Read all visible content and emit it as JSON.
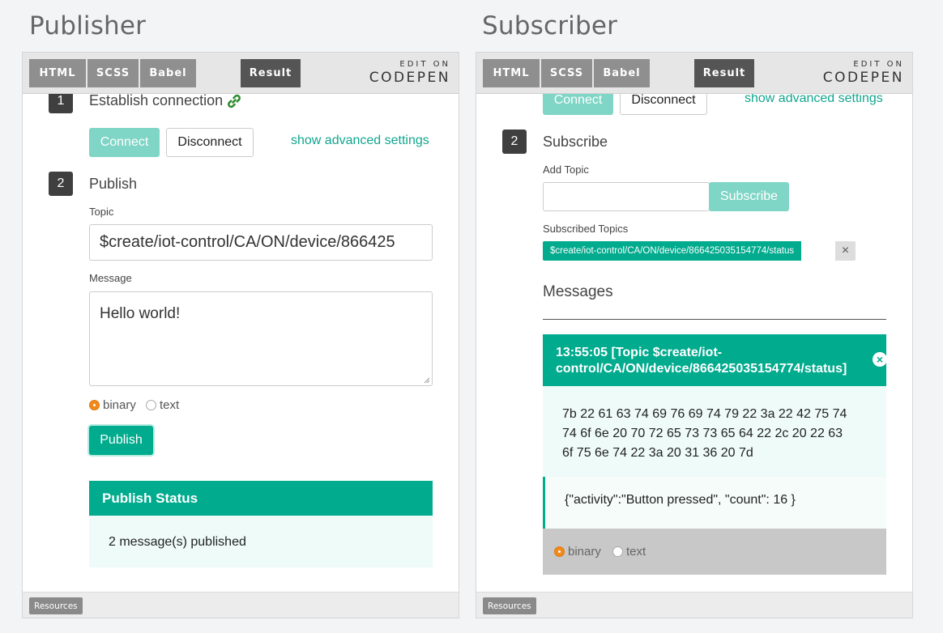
{
  "colors": {
    "accent": "#00ab8e",
    "accent_light": "#7fd5c6",
    "link": "#12a58f",
    "radio_on": "#f08a1c"
  },
  "codepen": {
    "tabs": [
      "HTML",
      "SCSS",
      "Babel"
    ],
    "result": "Result",
    "edit_on": "EDIT ON",
    "brand": "CODEPEN",
    "resources": "Resources"
  },
  "publisher": {
    "title": "Publisher",
    "step1": {
      "number": "1",
      "label": "Establish connection",
      "icon": "link-icon"
    },
    "connect_label": "Connect",
    "disconnect_label": "Disconnect",
    "advanced_label": "show advanced settings",
    "step2": {
      "number": "2",
      "label": "Publish"
    },
    "topic_label": "Topic",
    "topic_value": "$create/iot-control/CA/ON/device/866425",
    "message_label": "Message",
    "message_value": "Hello world!",
    "radio_binary": "binary",
    "radio_text": "text",
    "publish_label": "Publish",
    "status_title": "Publish Status",
    "status_text": "2 message(s) published"
  },
  "subscriber": {
    "title": "Subscriber",
    "connect_label": "Connect",
    "disconnect_label": "Disconnect",
    "advanced_label": "show advanced settings",
    "step2": {
      "number": "2",
      "label": "Subscribe"
    },
    "add_topic_label": "Add Topic",
    "add_topic_value": "",
    "subscribe_label": "Subscribe",
    "subscribed_label": "Subscribed Topics",
    "subscribed_topic": "$create/iot-control/CA/ON/device/866425035154774/status",
    "remove_icon": "×",
    "messages_title": "Messages",
    "message_header_line1": "13:55:05 [Topic $create/iot-",
    "message_header_line2": "control/CA/ON/device/866425035154774/status]",
    "close_icon": "×",
    "hex_line1": "7b 22 61 63 74 69 76 69 74 79 22 3a 22 42 75 74",
    "hex_line2": "74 6f 6e 20 70 72 65 73 73 65 64 22 2c 20 22 63",
    "hex_line3": "6f 75 6e 74 22 3a 20 31 36 20 7d",
    "decoded": "{\"activity\":\"Button pressed\", \"count\": 16 }",
    "radio_binary": "binary",
    "radio_text": "text"
  }
}
